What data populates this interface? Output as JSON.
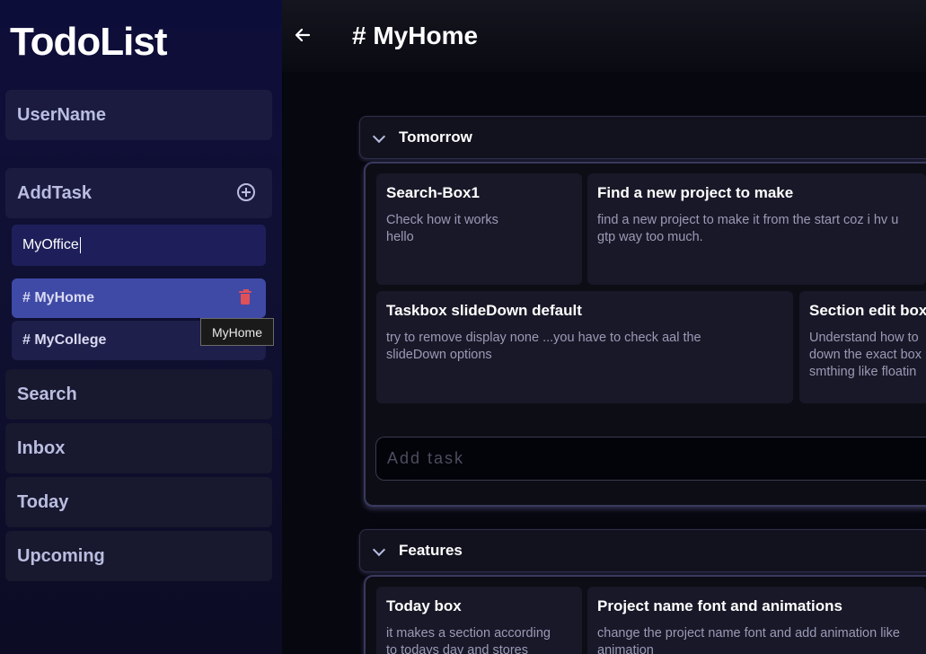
{
  "app": {
    "title": "TodoList"
  },
  "sidebar": {
    "username": "UserName",
    "add_task": "AddTask",
    "project_input_value": "MyOffice",
    "projects": [
      {
        "label": "# MyHome",
        "active": true
      },
      {
        "label": "# MyCollege",
        "active": false
      }
    ],
    "tooltip": "MyHome",
    "nav": [
      "Search",
      "Inbox",
      "Today",
      "Upcoming"
    ]
  },
  "main": {
    "page_title": "# MyHome",
    "add_task_placeholder": "Add task",
    "sections": [
      {
        "name": "Tomorrow",
        "tasks": [
          {
            "title": "Search-Box1",
            "desc": "Check how it works\nhello"
          },
          {
            "title": "Find a new project to make",
            "desc": "find a new project to make it from the start coz i hv u\ngtp way too much."
          },
          {
            "title": "Taskbox slideDown default",
            "desc": "try to remove display none ...you have to check aal the\nslideDown options"
          },
          {
            "title": "Section edit box",
            "desc": "Understand how to\ndown the exact box\nsmthing like floatin"
          }
        ]
      },
      {
        "name": "Features",
        "tasks": [
          {
            "title": "Today box",
            "desc": "it makes a section according\nto todays day and stores"
          },
          {
            "title": "Project name font and animations",
            "desc": "change the project name font and add animation like\nanimation"
          }
        ]
      }
    ]
  },
  "colors": {
    "sidebar_bg": "#0d0d3a",
    "active_project": "#3f4aa6",
    "trash": "#e0505a",
    "card_bg": "#181828"
  }
}
